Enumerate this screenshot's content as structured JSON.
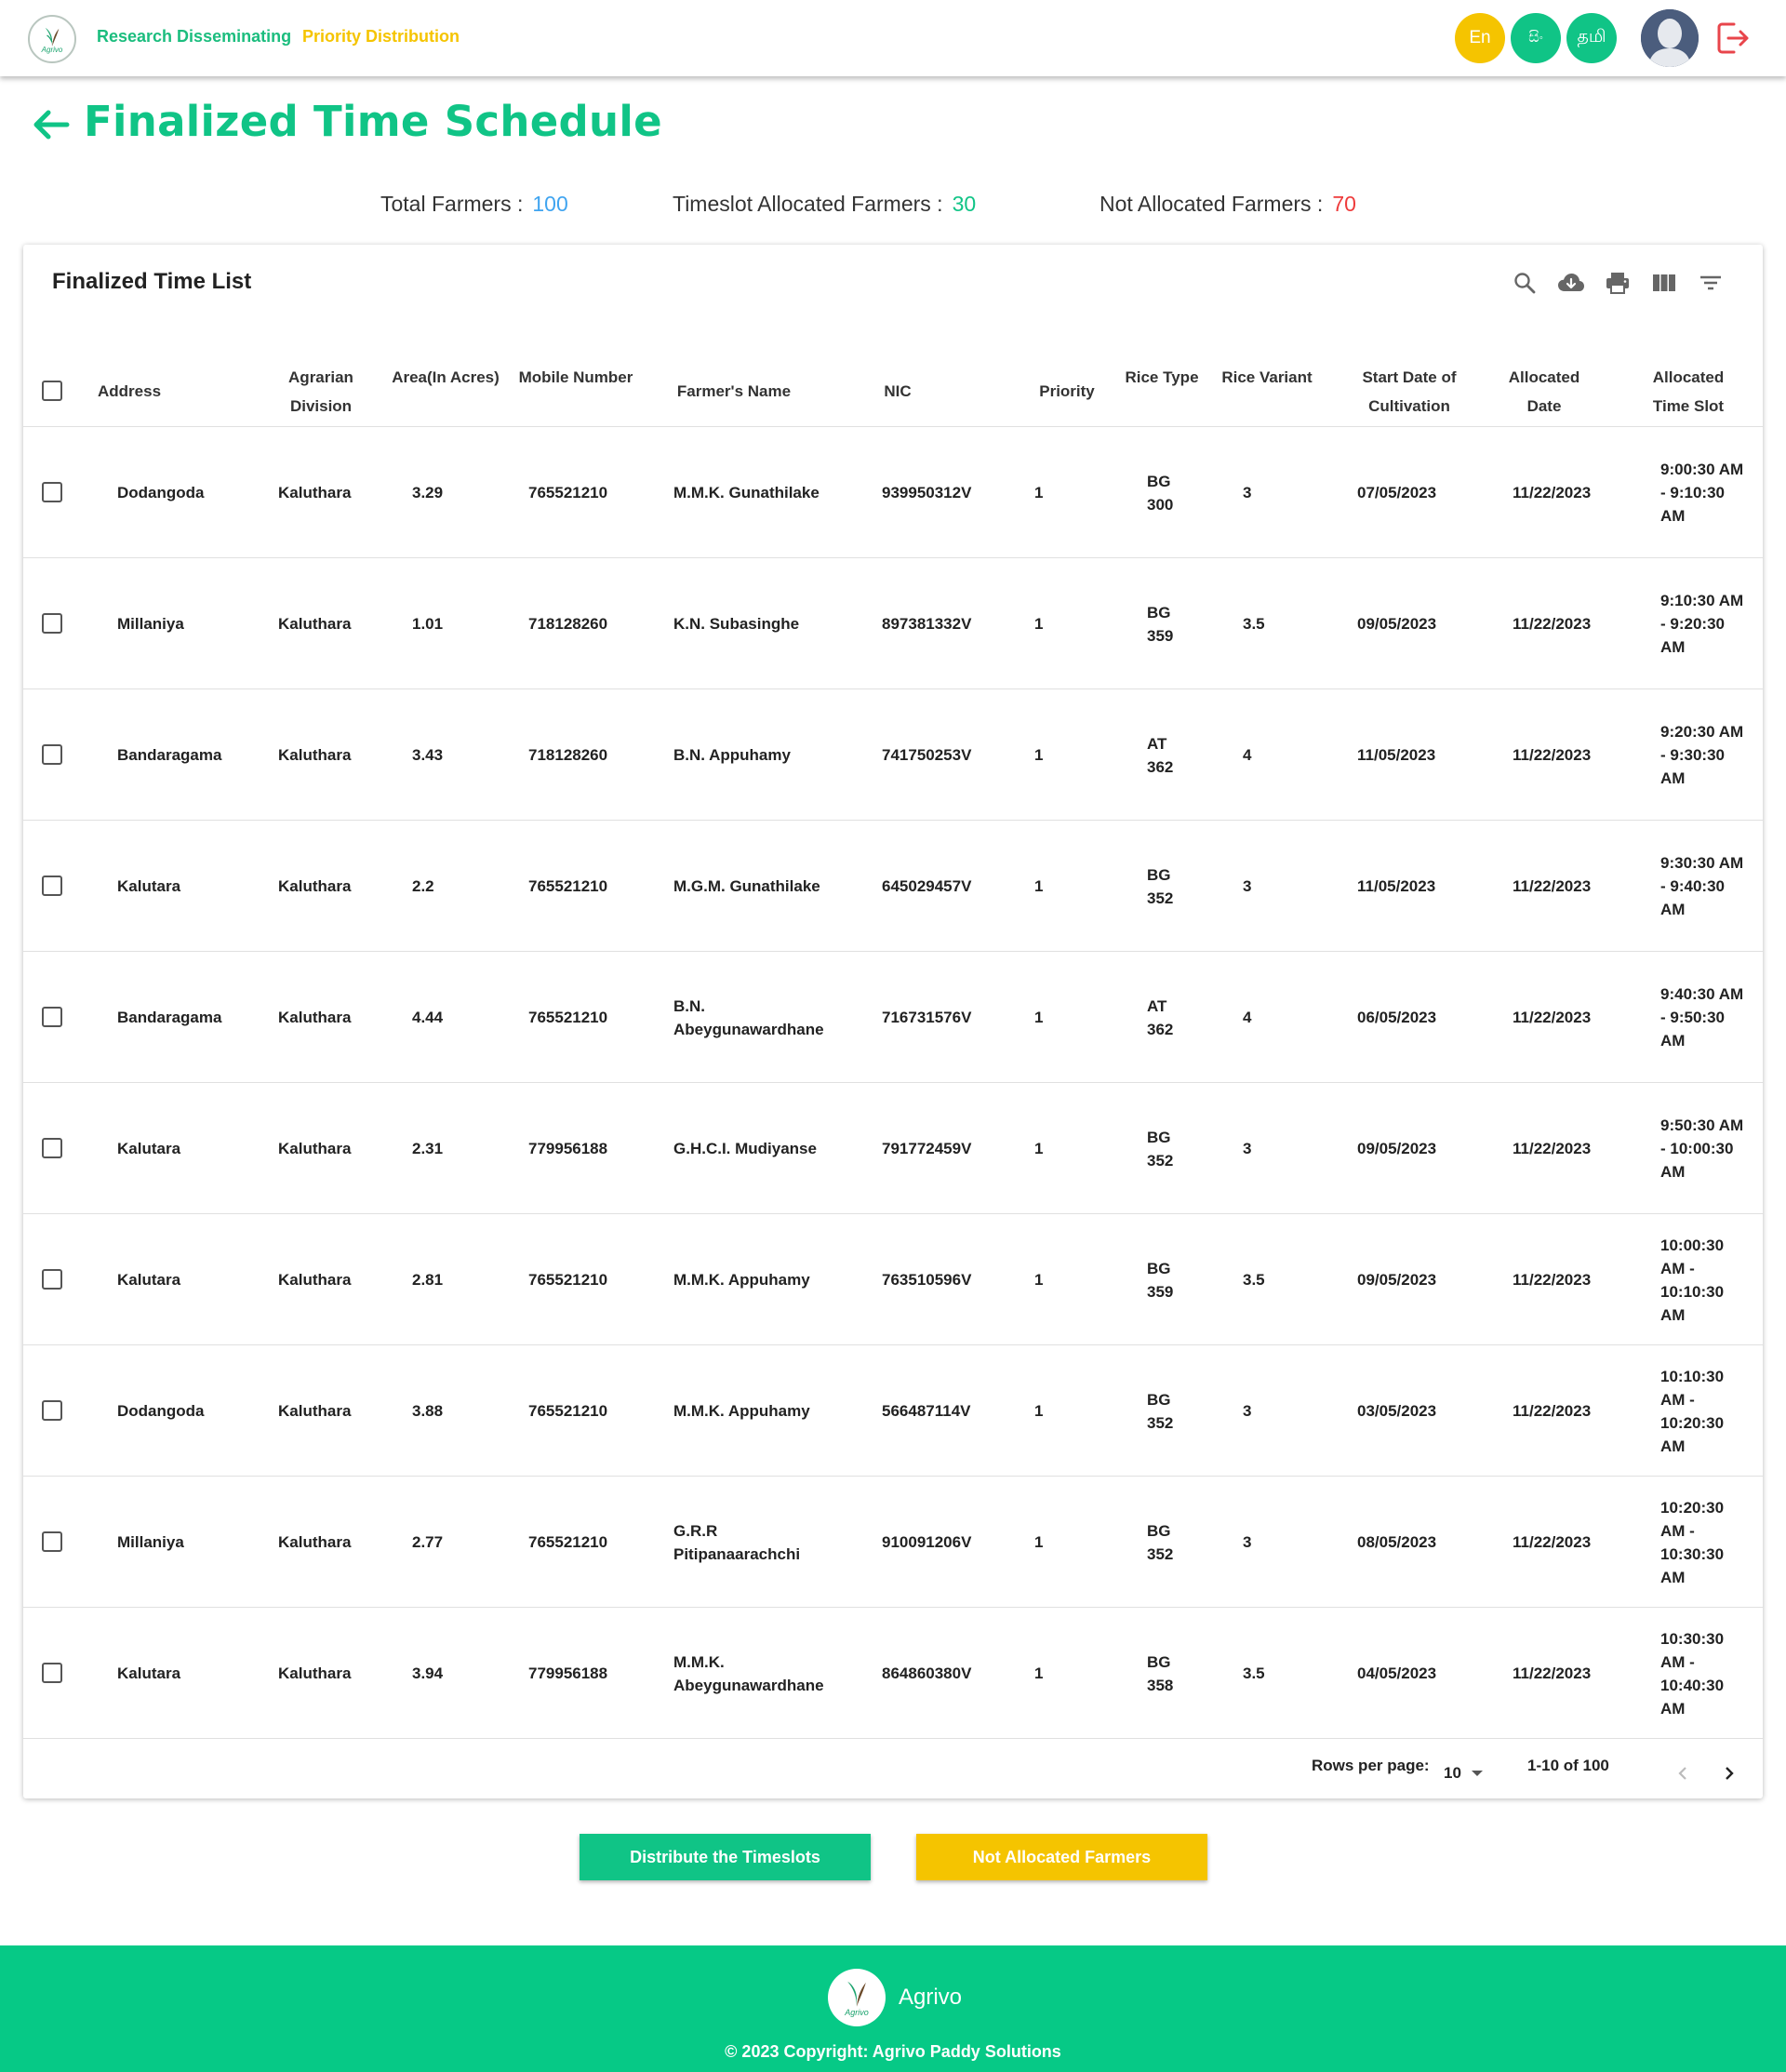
{
  "header": {
    "logo_text": "Agrivo",
    "nav": [
      "Research Disseminating",
      "Priority Distribution"
    ],
    "languages": [
      "En",
      "සිං",
      "தமி"
    ]
  },
  "page": {
    "title": "Finalized Time Schedule",
    "stats": {
      "total_label": "Total Farmers :",
      "total_value": "100",
      "allocated_label": "Timeslot Allocated Farmers :",
      "allocated_value": "30",
      "not_allocated_label": "Not Allocated Farmers :",
      "not_allocated_value": "70"
    }
  },
  "table": {
    "title": "Finalized Time List",
    "columns": [
      "Address",
      "Agrarian Division",
      "Area(In Acres)",
      "Mobile Number",
      "Farmer's Name",
      "NIC",
      "Priority",
      "Rice Type",
      "Rice Variant",
      "Start Date of Cultivation",
      "Allocated Date",
      "Allocated Time Slot"
    ],
    "rows": [
      {
        "address": "Dodangoda",
        "division": "Kaluthara",
        "area": "3.29",
        "mobile": "765521210",
        "name": "M.M.K. Gunathilake",
        "nic": "939950312V",
        "priority": "1",
        "rice_type": "BG 300",
        "variant": "3",
        "start": "07/05/2023",
        "alloc_date": "11/22/2023",
        "slot": "9:00:30 AM - 9:10:30 AM"
      },
      {
        "address": "Millaniya",
        "division": "Kaluthara",
        "area": "1.01",
        "mobile": "718128260",
        "name": "K.N. Subasinghe",
        "nic": "897381332V",
        "priority": "1",
        "rice_type": "BG 359",
        "variant": "3.5",
        "start": "09/05/2023",
        "alloc_date": "11/22/2023",
        "slot": "9:10:30 AM - 9:20:30 AM"
      },
      {
        "address": "Bandaragama",
        "division": "Kaluthara",
        "area": "3.43",
        "mobile": "718128260",
        "name": "B.N. Appuhamy",
        "nic": "741750253V",
        "priority": "1",
        "rice_type": "AT 362",
        "variant": "4",
        "start": "11/05/2023",
        "alloc_date": "11/22/2023",
        "slot": "9:20:30 AM - 9:30:30 AM"
      },
      {
        "address": "Kalutara",
        "division": "Kaluthara",
        "area": "2.2",
        "mobile": "765521210",
        "name": "M.G.M. Gunathilake",
        "nic": "645029457V",
        "priority": "1",
        "rice_type": "BG 352",
        "variant": "3",
        "start": "11/05/2023",
        "alloc_date": "11/22/2023",
        "slot": "9:30:30 AM - 9:40:30 AM"
      },
      {
        "address": "Bandaragama",
        "division": "Kaluthara",
        "area": "4.44",
        "mobile": "765521210",
        "name": "B.N. Abeygunawardhane",
        "nic": "716731576V",
        "priority": "1",
        "rice_type": "AT 362",
        "variant": "4",
        "start": "06/05/2023",
        "alloc_date": "11/22/2023",
        "slot": "9:40:30 AM - 9:50:30 AM"
      },
      {
        "address": "Kalutara",
        "division": "Kaluthara",
        "area": "2.31",
        "mobile": "779956188",
        "name": "G.H.C.I. Mudiyanse",
        "nic": "791772459V",
        "priority": "1",
        "rice_type": "BG 352",
        "variant": "3",
        "start": "09/05/2023",
        "alloc_date": "11/22/2023",
        "slot": "9:50:30 AM - 10:00:30 AM"
      },
      {
        "address": "Kalutara",
        "division": "Kaluthara",
        "area": "2.81",
        "mobile": "765521210",
        "name": "M.M.K. Appuhamy",
        "nic": "763510596V",
        "priority": "1",
        "rice_type": "BG 359",
        "variant": "3.5",
        "start": "09/05/2023",
        "alloc_date": "11/22/2023",
        "slot": "10:00:30 AM - 10:10:30 AM"
      },
      {
        "address": "Dodangoda",
        "division": "Kaluthara",
        "area": "3.88",
        "mobile": "765521210",
        "name": "M.M.K. Appuhamy",
        "nic": "566487114V",
        "priority": "1",
        "rice_type": "BG 352",
        "variant": "3",
        "start": "03/05/2023",
        "alloc_date": "11/22/2023",
        "slot": "10:10:30 AM - 10:20:30 AM"
      },
      {
        "address": "Millaniya",
        "division": "Kaluthara",
        "area": "2.77",
        "mobile": "765521210",
        "name": "G.R.R Pitipanaarachchi",
        "nic": "910091206V",
        "priority": "1",
        "rice_type": "BG 352",
        "variant": "3",
        "start": "08/05/2023",
        "alloc_date": "11/22/2023",
        "slot": "10:20:30 AM - 10:30:30 AM"
      },
      {
        "address": "Kalutara",
        "division": "Kaluthara",
        "area": "3.94",
        "mobile": "779956188",
        "name": "M.M.K. Abeygunawardhane",
        "nic": "864860380V",
        "priority": "1",
        "rice_type": "BG 358",
        "variant": "3.5",
        "start": "04/05/2023",
        "alloc_date": "11/22/2023",
        "slot": "10:30:30 AM - 10:40:30 AM"
      }
    ],
    "pagination": {
      "rows_per_page_label": "Rows per page:",
      "rows_per_page": "10",
      "range": "1-10 of 100"
    }
  },
  "actions": {
    "distribute": "Distribute the Timeslots",
    "not_allocated": "Not Allocated Farmers"
  },
  "footer": {
    "brand": "Agrivo",
    "copyright": "© 2023 Copyright: Agrivo Paddy Solutions"
  },
  "colors": {
    "primary_green": "#10c486",
    "accent_yellow": "#f5c400",
    "blue_stat": "#3fa4f0",
    "red_stat": "#ee3b3b"
  }
}
